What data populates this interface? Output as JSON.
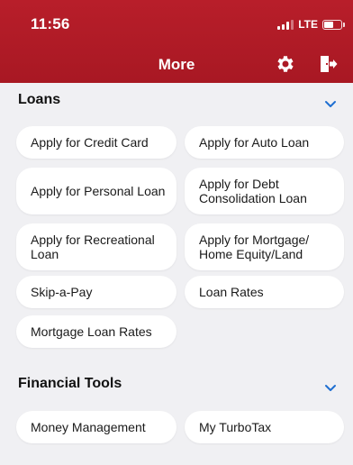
{
  "status": {
    "time": "11:56",
    "network": "LTE"
  },
  "nav": {
    "title": "More"
  },
  "sections": [
    {
      "title": "Loans",
      "items": [
        "Apply for Credit Card",
        "Apply for Auto Loan",
        "Apply for Personal Loan",
        "Apply for Debt Consolidation Loan",
        "Apply for Recreational Loan",
        "Apply for Mortgage/ Home Equity/Land",
        "Skip-a-Pay",
        "Loan Rates",
        "Mortgage Loan Rates"
      ]
    },
    {
      "title": "Financial Tools",
      "items": [
        "Money Management",
        "My TurboTax"
      ]
    }
  ],
  "colors": {
    "brand": "#b81e2a",
    "accent": "#1f6fd1",
    "background": "#f0f0f3"
  }
}
